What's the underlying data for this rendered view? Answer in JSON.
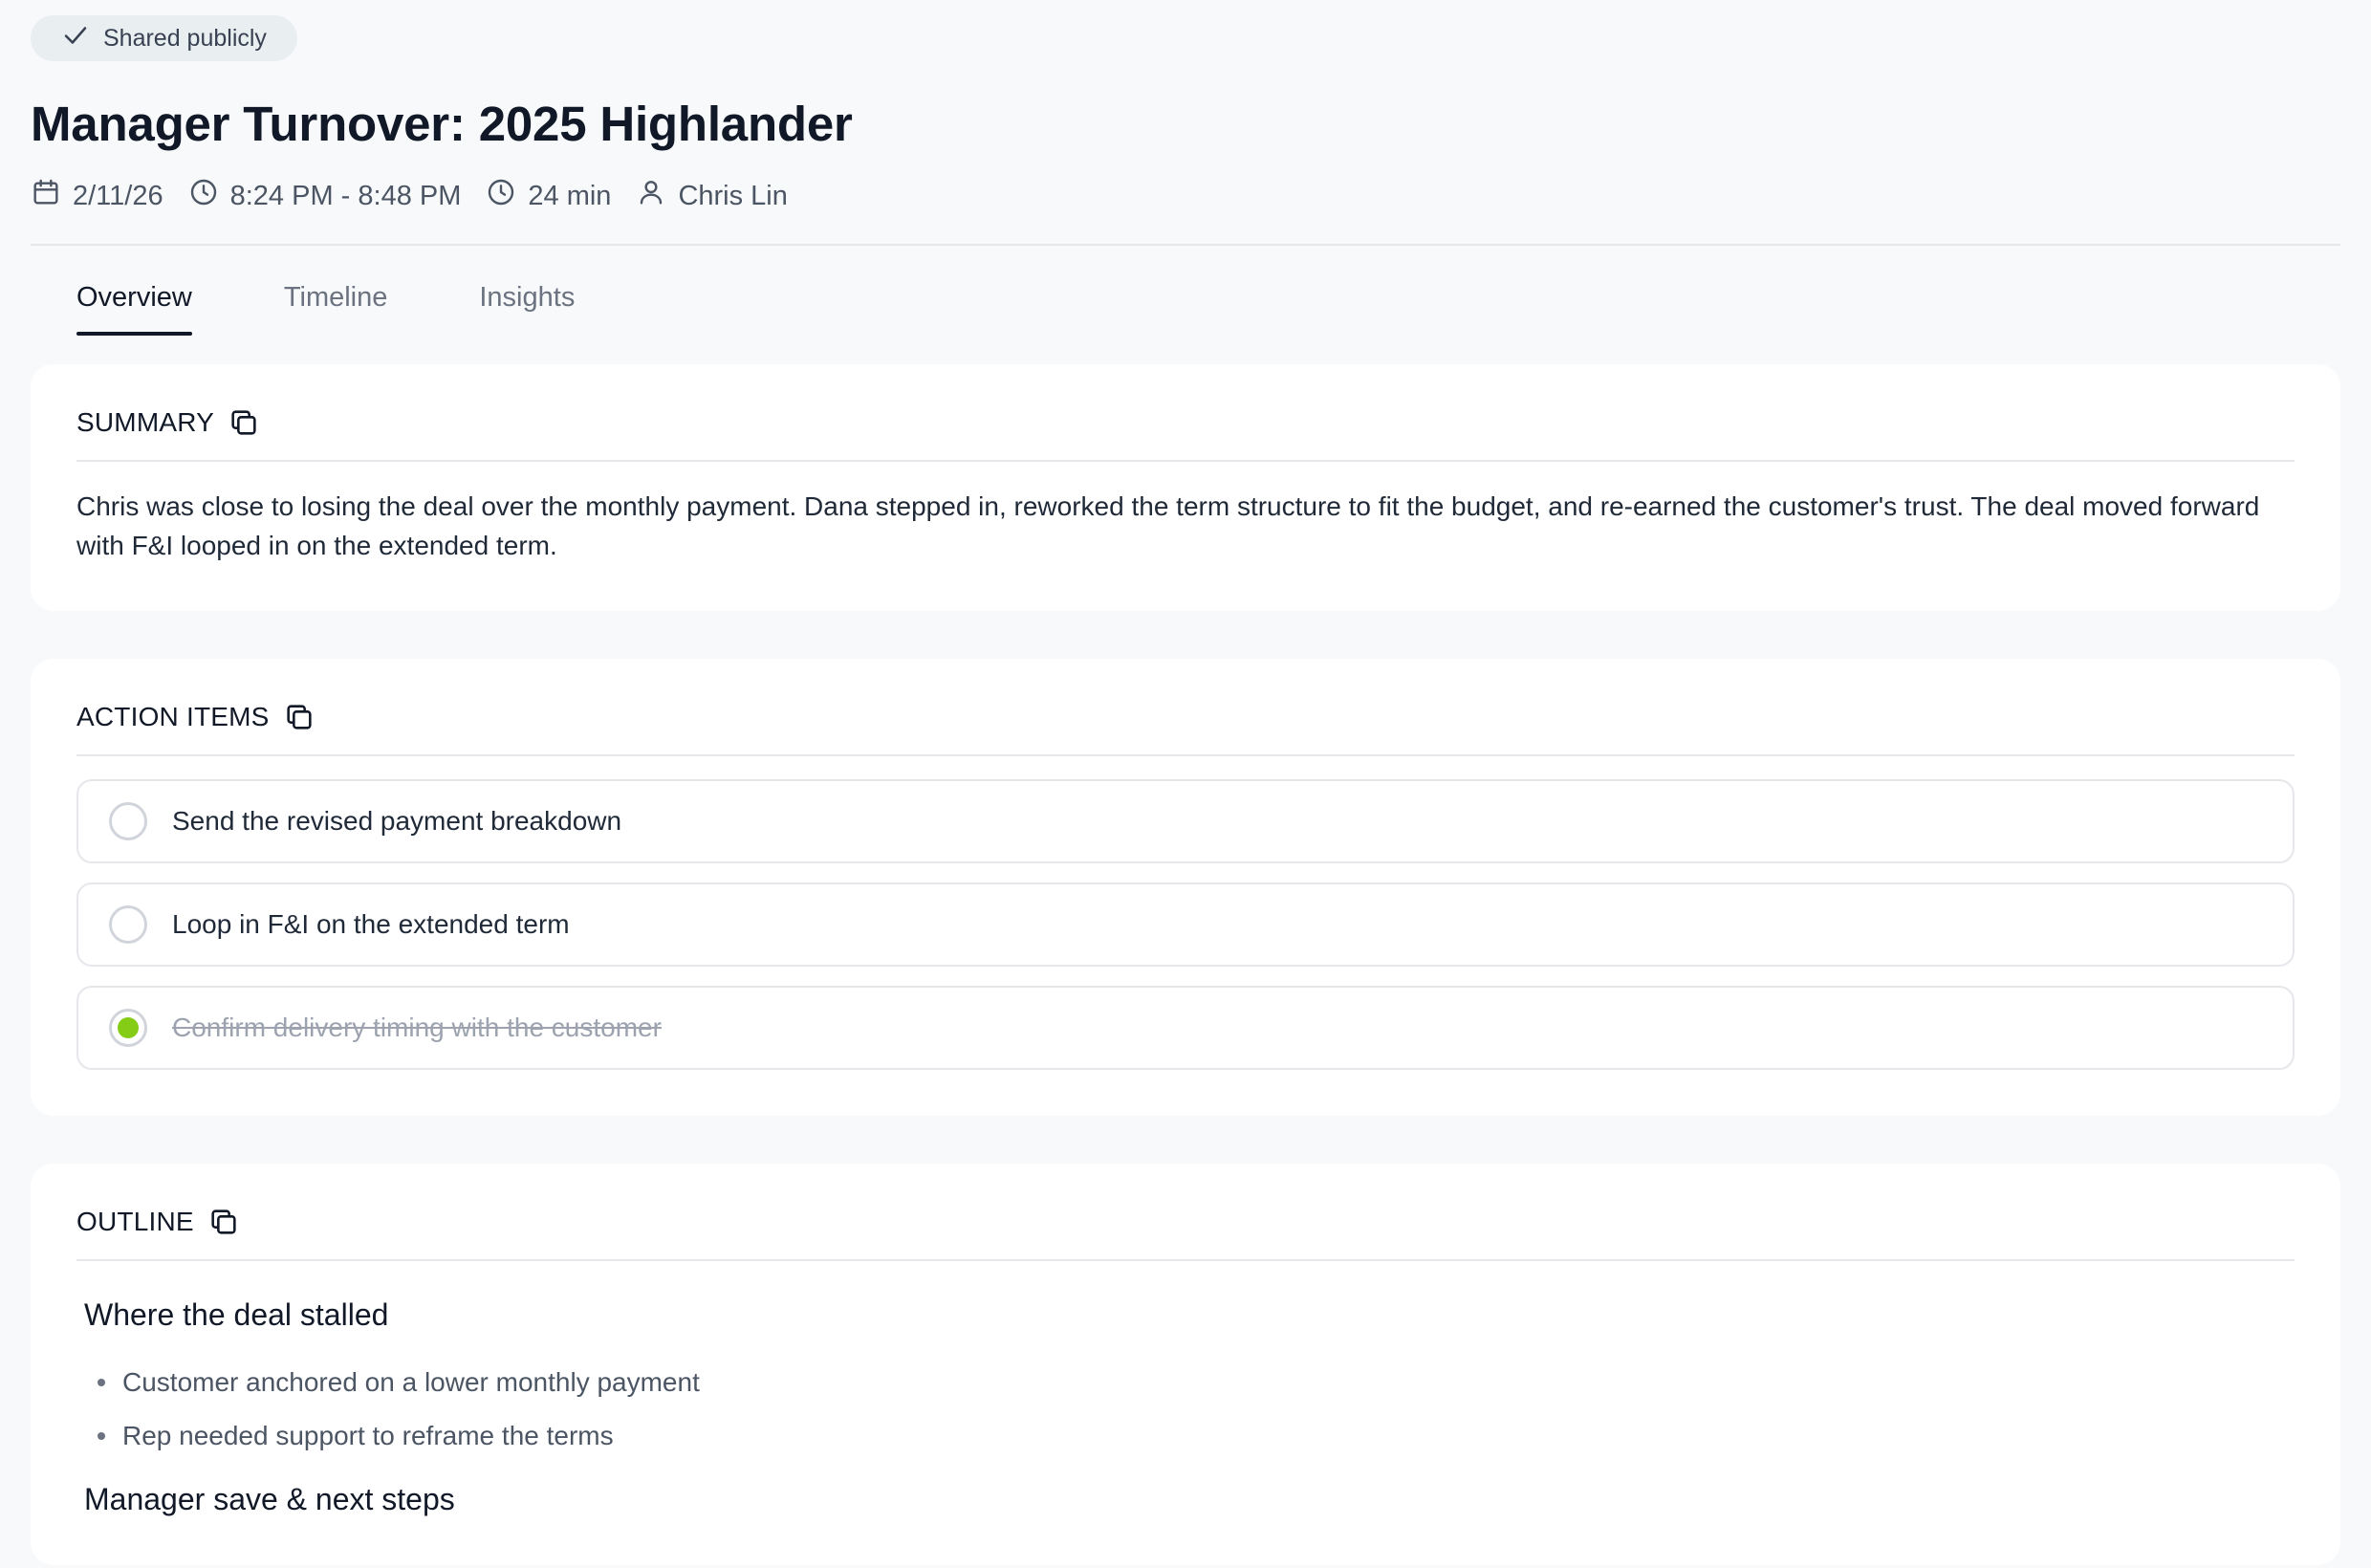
{
  "badge": {
    "label": "Shared publicly",
    "icon": "check-icon"
  },
  "title": "Manager Turnover: 2025 Highlander",
  "meta": {
    "date": "2/11/26",
    "time_range": "8:24 PM - 8:48 PM",
    "duration": "24 min",
    "person": "Chris Lin"
  },
  "tabs": [
    {
      "label": "Overview",
      "active": true
    },
    {
      "label": "Timeline",
      "active": false
    },
    {
      "label": "Insights",
      "active": false
    }
  ],
  "summary": {
    "heading": "SUMMARY",
    "text": "Chris was close to losing the deal over the monthly payment. Dana stepped in, reworked the term structure to fit the budget, and re-earned the customer's trust. The deal moved forward with F&I looped in on the extended term."
  },
  "action_items": {
    "heading": "ACTION ITEMS",
    "items": [
      {
        "label": "Send the revised payment breakdown",
        "done": false
      },
      {
        "label": "Loop in F&I on the extended term",
        "done": false
      },
      {
        "label": "Confirm delivery timing with the customer",
        "done": true
      }
    ]
  },
  "outline": {
    "heading": "OUTLINE",
    "sections": [
      {
        "title": "Where the deal stalled",
        "bullets": [
          "Customer anchored on a lower monthly payment",
          "Rep needed support to reframe the terms"
        ]
      },
      {
        "title": "Manager save & next steps",
        "bullets": []
      }
    ]
  },
  "colors": {
    "accent_done": "#84cc16",
    "badge_bg": "#e9eff1",
    "page_bg": "#f8f9fb"
  }
}
